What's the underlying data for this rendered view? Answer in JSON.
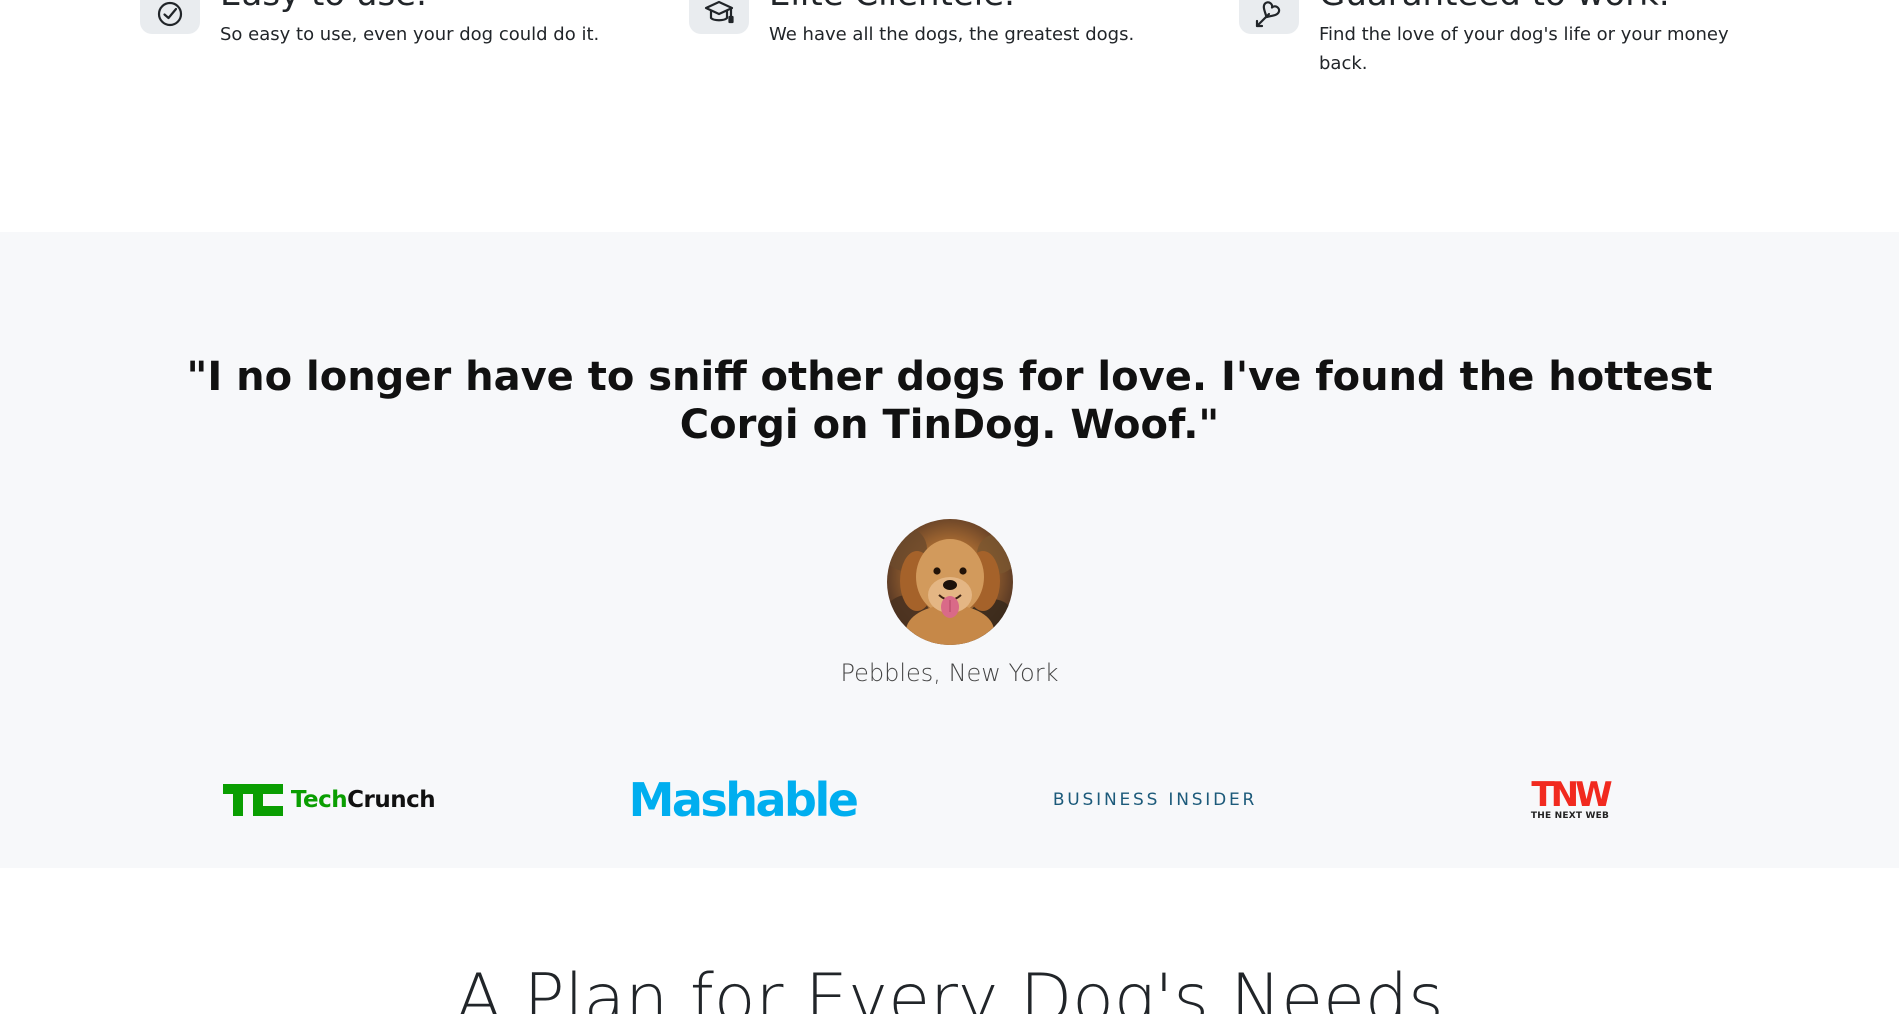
{
  "features": [
    {
      "icon": "check-circle-icon",
      "title": "Easy to use.",
      "description": "So easy to use, even your dog could do it."
    },
    {
      "icon": "graduation-cap-icon",
      "title": "Elite Clientele.",
      "description": "We have all the dogs, the greatest dogs."
    },
    {
      "icon": "heart-arrow-icon",
      "title": "Guaranteed to work.",
      "description": "Find the love of your dog's life or your money back."
    }
  ],
  "testimonial": {
    "quote": "\"I no longer have to sniff other dogs for love. I've found the hottest Corgi on TinDog. Woof.\"",
    "author": "Pebbles, New York",
    "avatar_icon": "dog-avatar"
  },
  "press": {
    "techcrunch": {
      "part1": "Tech",
      "part2": "Crunch"
    },
    "mashable": "Mashable",
    "business_insider": "BUSINESS INSIDER",
    "tnw": {
      "mark": "TNW",
      "caption": "THE NEXT WEB"
    }
  },
  "pricing": {
    "title": "A Plan for Every Dog's Needs"
  },
  "colors": {
    "testimonial_bg": "#f7f8fa",
    "techcrunch_green": "#0a9e01",
    "mashable_blue": "#00aeef",
    "business_insider_blue": "#1c5a7a",
    "tnw_red": "#f12a1f",
    "icon_bg": "#e9ecef"
  }
}
